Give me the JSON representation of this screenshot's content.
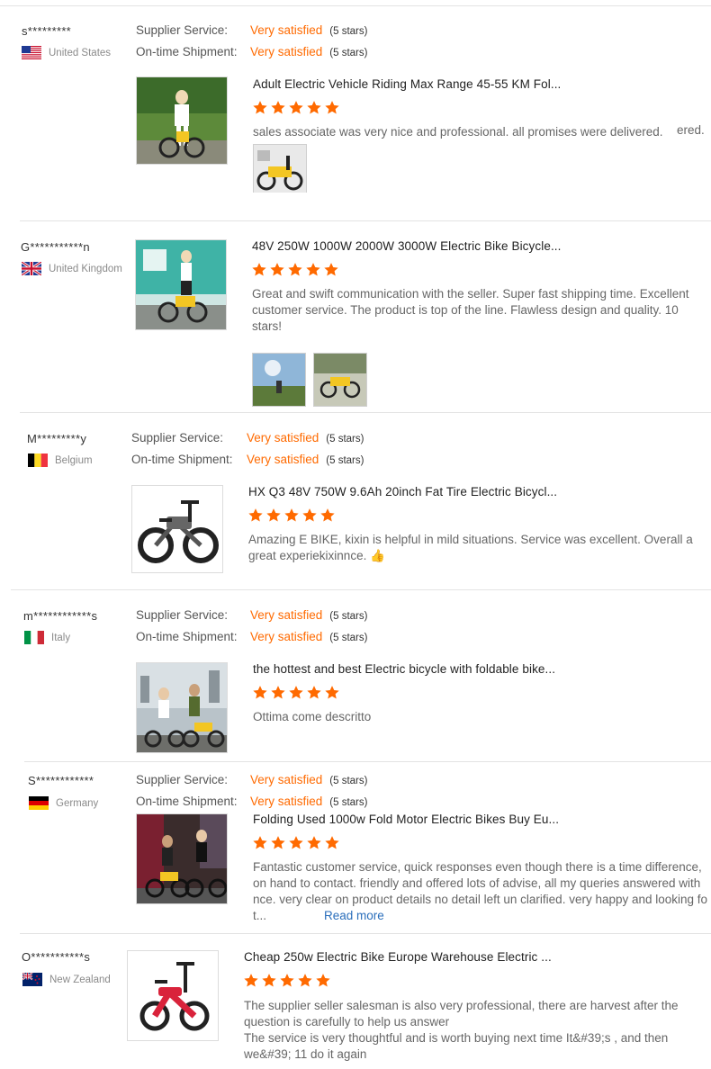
{
  "labels": {
    "supplier_service": "Supplier Service:",
    "ontime_shipment": "On-time Shipment:",
    "very_satisfied": "Very satisfied",
    "five_stars": "(5 stars)",
    "read_more": "Read more"
  },
  "colors": {
    "accent": "#ff6a00",
    "link": "#2a6ebb"
  },
  "reviews": [
    {
      "user": "s*********",
      "country": "United States",
      "flag": "us-flag",
      "product_title": "Adult Electric Vehicle Riding Max Range 45-55 KM Fol...",
      "rating": 5,
      "text": "sales associate was very nice and professional. all promises were delivered.",
      "text_tail": "ered."
    },
    {
      "user": "G***********n",
      "country": "United Kingdom",
      "flag": "uk-flag",
      "product_title": "48V 250W 1000W 2000W 3000W Electric Bike Bicycle...",
      "rating": 5,
      "text": "Great and swift communication with the seller. Super fast shipping time. Excellent customer service. The product is top of the line. Flawless design and quality. 10 stars!"
    },
    {
      "user": "M*********y",
      "country": "Belgium",
      "flag": "belgium-flag",
      "product_title": "HX Q3 48V 750W 9.6Ah 20inch Fat Tire Electric Bicycl...",
      "rating": 5,
      "text": "Amazing E BIKE, kixin is helpful in mild situations. Service was excellent. Overall a great experiekixinnce. 👍"
    },
    {
      "user": "m************s",
      "country": "Italy",
      "flag": "italy-flag",
      "product_title": "the hottest and best Electric bicycle with foldable bike...",
      "rating": 5,
      "text": "Ottima come descritto"
    },
    {
      "user": "S************",
      "country": "Germany",
      "flag": "germany-flag",
      "product_title": "Folding Used 1000w Fold Motor Electric Bikes Buy Eu...",
      "rating": 5,
      "text_line1": "Fantastic customer service, quick responses even though there is a time difference,",
      "text_line2": "on hand to contact. friendly and offered lots of advise, all my queries answered with",
      "text_line3": "nce. very clear on product details no detail left un clarified. very happy and looking fo",
      "text_line4": "t..."
    },
    {
      "user": "O***********s",
      "country": "New Zealand",
      "flag": "new-zealand-flag",
      "product_title": "Cheap 250w Electric Bike Europe Warehouse Electric ...",
      "rating": 5,
      "text": "The supplier seller salesman is also very professional, there are harvest after the question is carefully to help us answer\nThe service is very thoughtful and is worth buying next time It&#39;s , and then we&#39; 11 do it again"
    }
  ]
}
